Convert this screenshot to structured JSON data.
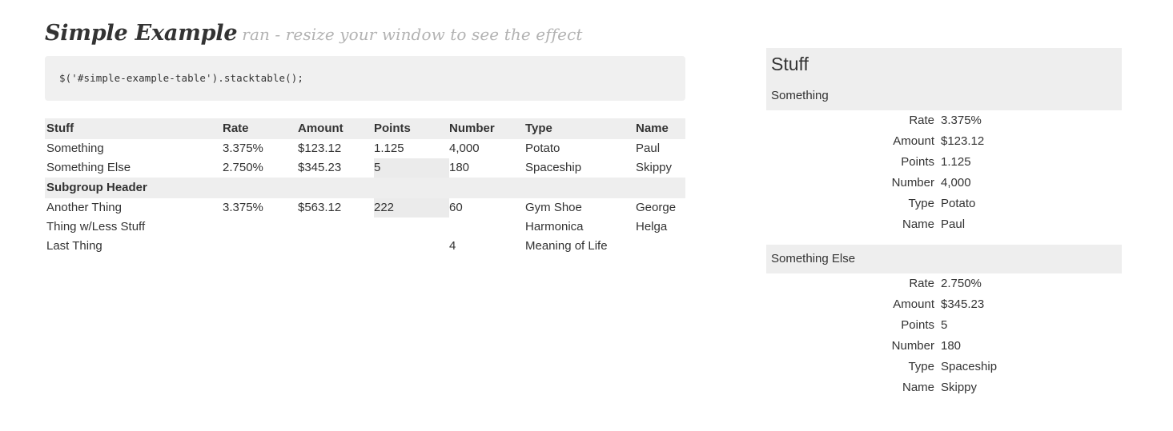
{
  "heading": {
    "title": "Simple Example",
    "subtitle": "ran - resize your window to see the effect"
  },
  "code_block": {
    "code": "$('#simple-example-table').stacktable();"
  },
  "simple_table": {
    "columns": [
      "Stuff",
      "Rate",
      "Amount",
      "Points",
      "Number",
      "Type",
      "Name"
    ],
    "rows": [
      {
        "type": "data",
        "cells": [
          "Something",
          "3.375%",
          "$123.12",
          "1.125",
          "4,000",
          "Potato",
          "Paul"
        ],
        "highlight": []
      },
      {
        "type": "data",
        "cells": [
          "Something Else",
          "2.750%",
          "$345.23",
          "5",
          "180",
          "Spaceship",
          "Skippy"
        ],
        "highlight": [
          3
        ]
      },
      {
        "type": "subgroup",
        "cells": [
          "Subgroup Header",
          "",
          "",
          "",
          "",
          "",
          ""
        ],
        "highlight": []
      },
      {
        "type": "data",
        "cells": [
          "Another Thing",
          "3.375%",
          "$563.12",
          "222",
          "60",
          "Gym Shoe",
          "George"
        ],
        "highlight": [
          3
        ]
      },
      {
        "type": "data",
        "cells": [
          "Thing w/Less Stuff",
          "",
          "",
          "",
          "",
          "Harmonica",
          "Helga"
        ],
        "highlight": []
      },
      {
        "type": "data",
        "cells": [
          "Last Thing",
          "",
          "",
          "",
          "4",
          "Meaning of Life",
          ""
        ],
        "highlight": []
      }
    ]
  },
  "stack_table": {
    "title": "Stuff",
    "groups": [
      {
        "label": "Something",
        "pairs": [
          {
            "key": "Rate",
            "value": "3.375%"
          },
          {
            "key": "Amount",
            "value": "$123.12"
          },
          {
            "key": "Points",
            "value": "1.125"
          },
          {
            "key": "Number",
            "value": "4,000"
          },
          {
            "key": "Type",
            "value": "Potato"
          },
          {
            "key": "Name",
            "value": "Paul"
          }
        ]
      },
      {
        "label": "Something Else",
        "pairs": [
          {
            "key": "Rate",
            "value": "2.750%"
          },
          {
            "key": "Amount",
            "value": "$345.23"
          },
          {
            "key": "Points",
            "value": "5"
          },
          {
            "key": "Number",
            "value": "180"
          },
          {
            "key": "Type",
            "value": "Spaceship"
          },
          {
            "key": "Name",
            "value": "Skippy"
          }
        ]
      }
    ]
  },
  "colors": {
    "band": "#eeeeee",
    "code_bg": "#f0f0f0",
    "highlight_cell": "#ebebeb",
    "text": "#333333",
    "subtitle": "#b3b3b3"
  }
}
